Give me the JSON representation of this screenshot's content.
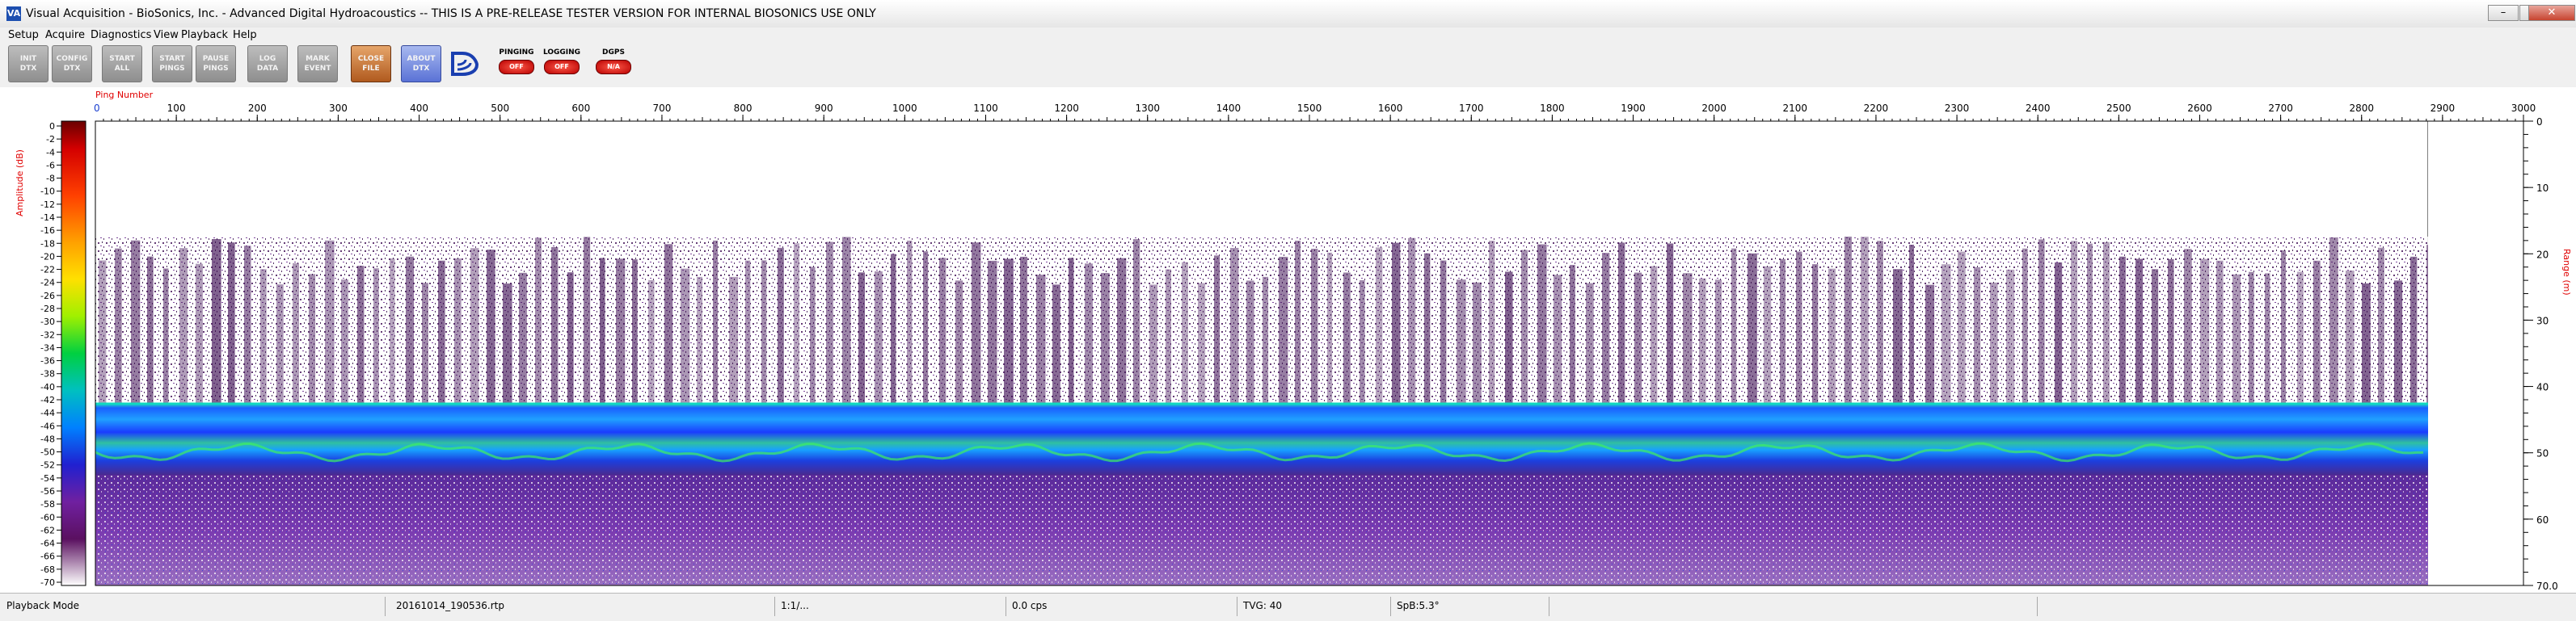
{
  "window": {
    "icon_text": "VA",
    "title": "Visual Acquisition  -  BioSonics, Inc.  -  Advanced Digital Hydroacoustics  --  THIS IS A PRE-RELEASE TESTER VERSION FOR INTERNAL BIOSONICS USE ONLY"
  },
  "menu": [
    "Setup",
    "Acquire",
    "Diagnostics",
    "View",
    "Playback",
    "Help"
  ],
  "toolbar": {
    "buttons": [
      {
        "label": "INIT\nDTX",
        "style": "gray"
      },
      {
        "label": "CONFIG\nDTX",
        "style": "gray"
      },
      {
        "label": "START\nALL",
        "style": "gray"
      },
      {
        "label": "START\nPINGS",
        "style": "gray"
      },
      {
        "label": "PAUSE\nPINGS",
        "style": "gray"
      },
      {
        "label": "LOG\nDATA",
        "style": "gray"
      },
      {
        "label": "MARK\nEVENT",
        "style": "gray"
      },
      {
        "label": "CLOSE\nFILE",
        "style": "orange"
      },
      {
        "label": "ABOUT\nDTX",
        "style": "blue"
      }
    ],
    "indicators": [
      {
        "label": "PINGING",
        "state": "OFF"
      },
      {
        "label": "LOGGING",
        "state": "OFF"
      },
      {
        "label": "DGPS",
        "state": "N/A"
      }
    ]
  },
  "echogram": {
    "x_axis_label": "Ping Number",
    "x_ticks": [
      "100",
      "200",
      "300",
      "400",
      "500",
      "600",
      "700",
      "800",
      "900",
      "1000",
      "1100",
      "1200",
      "1300",
      "1400",
      "1500",
      "1600",
      "1700",
      "1800",
      "1900",
      "2000",
      "2100",
      "2200",
      "2300",
      "2400",
      "2500",
      "2600",
      "2700",
      "2800",
      "2900",
      "3000"
    ],
    "x_zero_label": "0",
    "right_axis_label": "Range (m)",
    "right_ticks": [
      "0",
      "10",
      "20",
      "30",
      "40",
      "50",
      "60",
      "70.0"
    ],
    "left_axis_label": "Amplitude (dB)",
    "colorbar_ticks": [
      "0",
      "-2",
      "-4",
      "-6",
      "-8",
      "-10",
      "-12",
      "-14",
      "-16",
      "-18",
      "-20",
      "-22",
      "-24",
      "-26",
      "-28",
      "-30",
      "-32",
      "-34",
      "-36",
      "-38",
      "-40",
      "-42",
      "-44",
      "-46",
      "-48",
      "-50",
      "-52",
      "-54",
      "-56",
      "-58",
      "-60",
      "-62",
      "-64",
      "-66",
      "-68",
      "-70"
    ],
    "colors": {
      "water_noise": "#4a1a5e",
      "bottom_band": "#1f7bff",
      "bottom_line": "#20c0c0",
      "sediment": "#5a2a9a"
    }
  },
  "statusbar": {
    "mode": "Playback Mode",
    "file": "20161014_190536.rtp",
    "ratio": "1:1/...",
    "cps": "0.0 cps",
    "tvg": "TVG: 40",
    "spb": "SpB:5.3°"
  }
}
